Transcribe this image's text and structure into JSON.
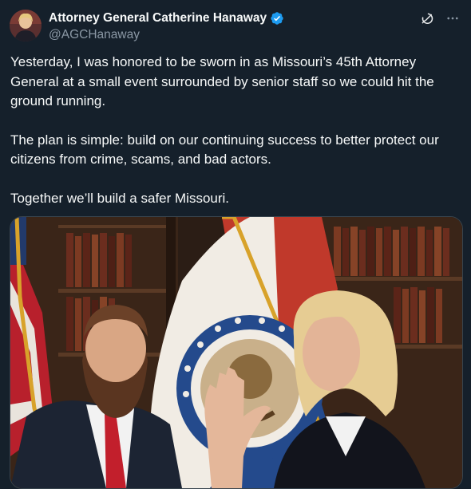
{
  "author": {
    "name": "Attorney General Catherine Hanaway",
    "handle": "@AGCHanaway"
  },
  "post": {
    "paragraphs": [
      "Yesterday, I was honored to be sworn in as Missouri’s 45th Attorney General at a small event surrounded by senior staff so we could hit the ground running.",
      "The plan is simple: build on our continuing success to better protect our citizens from crime, scams, and bad actors.",
      "Together we’ll build a safer Missouri."
    ]
  },
  "icons": {
    "verified": "verified-badge-icon",
    "grok": "grok-icon",
    "more": "more-options-icon"
  },
  "colors": {
    "background": "#15202b",
    "text": "#f7f9f9",
    "secondary_text": "#8b98a5",
    "verified_blue": "#1d9bf0",
    "border": "#38444d"
  }
}
